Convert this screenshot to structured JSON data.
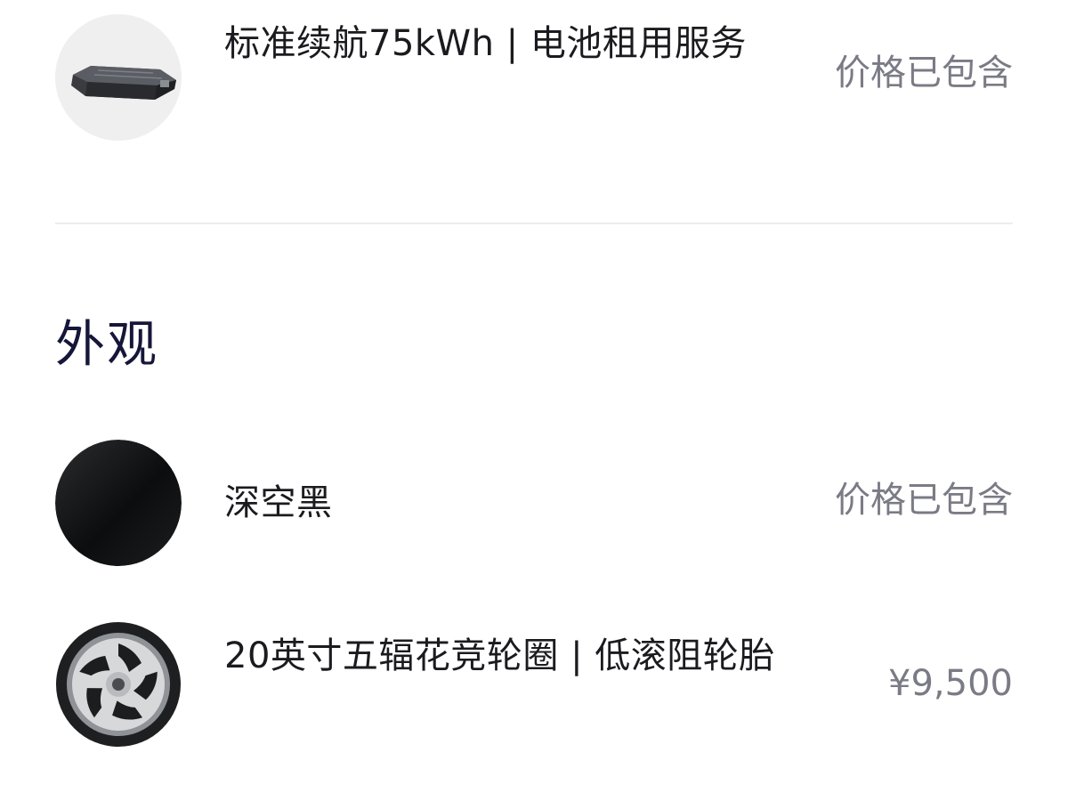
{
  "battery_item": {
    "title": "标准续航75kWh | 电池租用服务",
    "price": "价格已包含",
    "icon": "battery-pack-image"
  },
  "exterior": {
    "section_title": "外观",
    "color_item": {
      "title": "深空黑",
      "price": "价格已包含",
      "icon": "color-swatch-black"
    },
    "wheel_item": {
      "title": "20英寸五辐花竞轮圈 | 低滚阻轮胎",
      "price": "¥9,500",
      "icon": "wheel-rim-image"
    }
  },
  "colors": {
    "price_text": "#7b7b86",
    "section_title": "#16163a",
    "divider": "#ececf0"
  }
}
